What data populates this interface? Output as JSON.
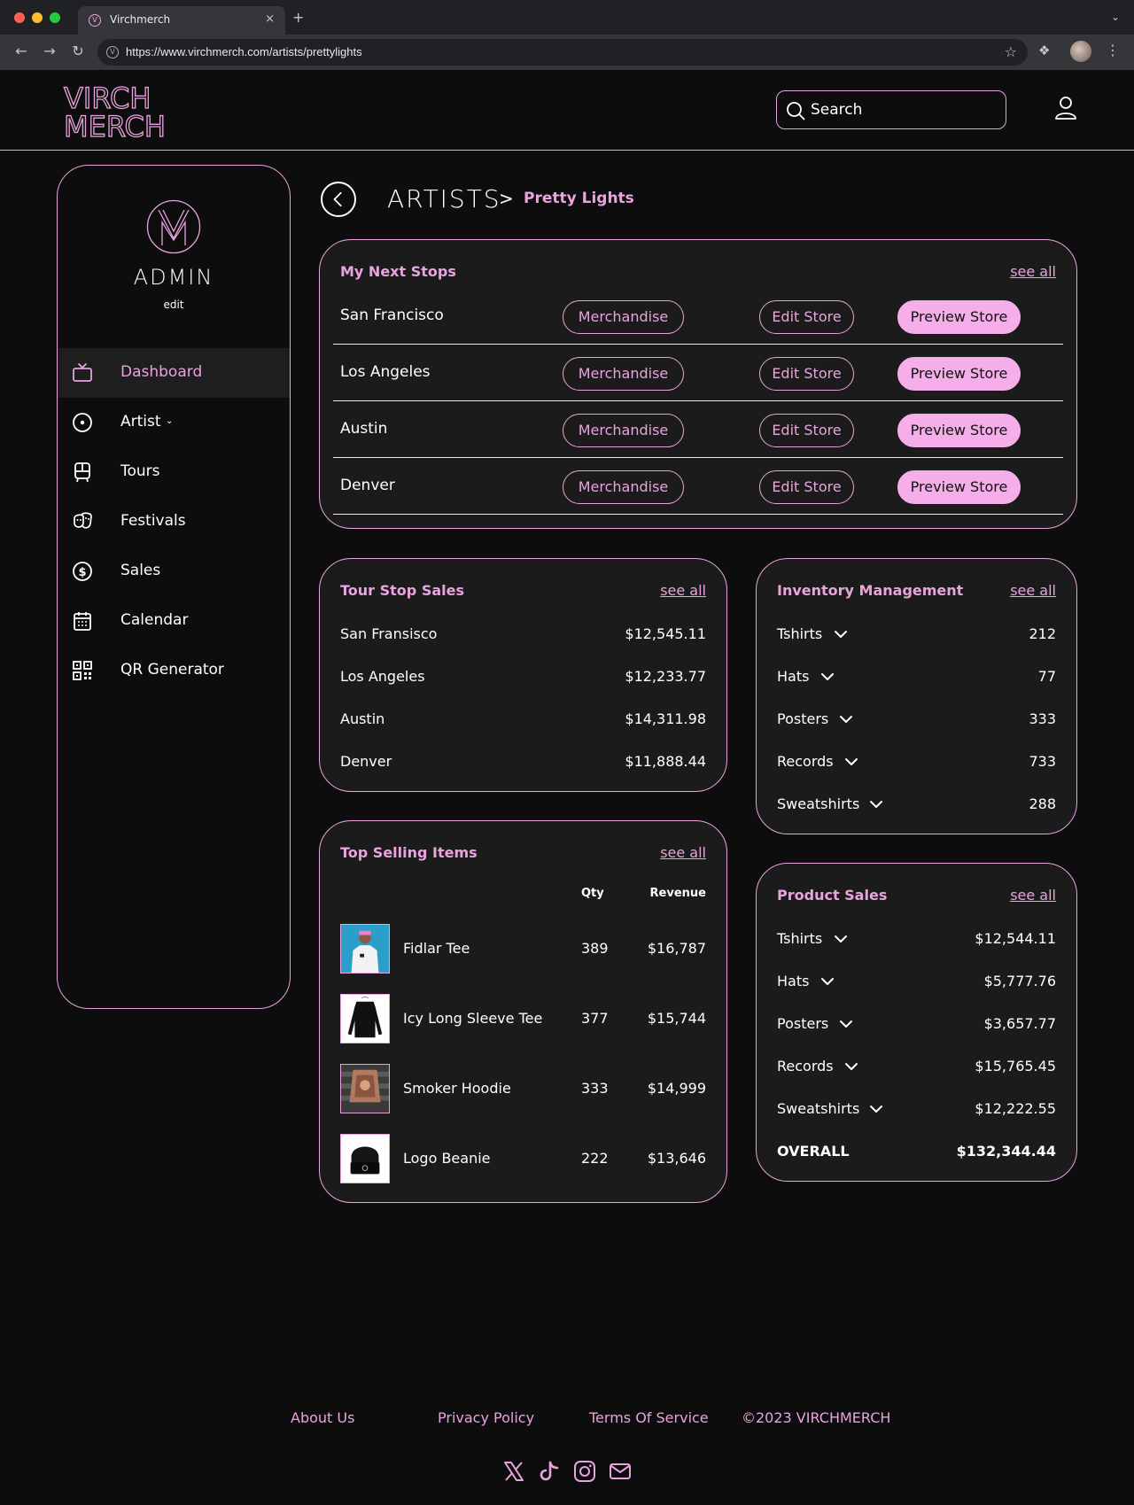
{
  "browser": {
    "tab_title": "Virchmerch",
    "new_tab": "+",
    "close": "×",
    "url": "https://www.virchmerch.com/artists/prettylights"
  },
  "header": {
    "logo_line1": "VIRCH",
    "logo_line2": "MERCH",
    "search_placeholder": "Search"
  },
  "sidebar": {
    "avatar_letters": "VM",
    "user_name": "ADMIN",
    "edit_label": "edit",
    "items": [
      {
        "label": "Dashboard",
        "icon": "tv-icon",
        "active": true
      },
      {
        "label": "Artist",
        "icon": "disc-icon",
        "has_caret": true
      },
      {
        "label": "Tours",
        "icon": "bus-icon"
      },
      {
        "label": "Festivals",
        "icon": "masks-icon"
      },
      {
        "label": "Sales",
        "icon": "dollar-icon"
      },
      {
        "label": "Calendar",
        "icon": "calendar-icon"
      },
      {
        "label": "QR Generator",
        "icon": "qr-icon"
      }
    ]
  },
  "breadcrumb": {
    "root": "ARTISTS",
    "separator": ">",
    "current": "Pretty Lights"
  },
  "next_stops": {
    "title": "My Next Stops",
    "see_all": "see all",
    "merch_label": "Merchandise",
    "edit_label": "Edit Store",
    "preview_label": "Preview Store",
    "stops": [
      "San Francisco",
      "Los Angeles",
      "Austin",
      "Denver"
    ]
  },
  "tour_sales": {
    "title": "Tour Stop Sales",
    "see_all": "see all",
    "rows": [
      {
        "city": "San Fransisco",
        "amount": "$12,545.11"
      },
      {
        "city": "Los Angeles",
        "amount": "$12,233.77"
      },
      {
        "city": "Austin",
        "amount": "$14,311.98"
      },
      {
        "city": "Denver",
        "amount": "$11,888.44"
      }
    ]
  },
  "inventory": {
    "title": "Inventory Management",
    "see_all": "see all",
    "rows": [
      {
        "label": "Tshirts",
        "value": "212"
      },
      {
        "label": "Hats",
        "value": "77"
      },
      {
        "label": "Posters",
        "value": "333"
      },
      {
        "label": "Records",
        "value": "733"
      },
      {
        "label": "Sweatshirts",
        "value": "288"
      }
    ]
  },
  "top_items": {
    "title": "Top Selling Items",
    "see_all": "see all",
    "col_qty": "Qty",
    "col_revenue": "Revenue",
    "items": [
      {
        "name": "Fidlar Tee",
        "qty": "389",
        "revenue": "$16,787"
      },
      {
        "name": "Icy Long Sleeve Tee",
        "qty": "377",
        "revenue": "$15,744"
      },
      {
        "name": "Smoker Hoodie",
        "qty": "333",
        "revenue": "$14,999"
      },
      {
        "name": "Logo Beanie",
        "qty": "222",
        "revenue": "$13,646"
      }
    ]
  },
  "product_sales": {
    "title": "Product Sales",
    "see_all": "see all",
    "rows": [
      {
        "label": "Tshirts",
        "value": "$12,544.11"
      },
      {
        "label": "Hats",
        "value": "$5,777.76"
      },
      {
        "label": "Posters",
        "value": "$3,657.77"
      },
      {
        "label": "Records",
        "value": "$15,765.45"
      },
      {
        "label": "Sweatshirts",
        "value": "$12,222.55"
      }
    ],
    "overall_label": "OVERALL",
    "overall_value": "$132,344.44"
  },
  "footer": {
    "links": [
      "About Us",
      "Privacy Policy",
      "Terms Of Service"
    ],
    "copyright": "©2023 VIRCHMERCH",
    "social": [
      "x-icon",
      "tiktok-icon",
      "instagram-icon",
      "mail-icon"
    ]
  },
  "colors": {
    "accent": "#e9a3de",
    "accent_fill": "#f6aeea",
    "background": "#0d0d0d",
    "card": "#1b1b1b"
  }
}
